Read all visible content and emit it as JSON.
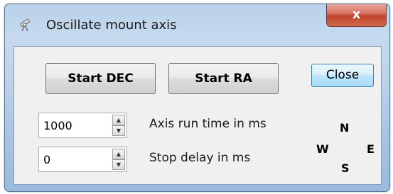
{
  "window": {
    "title": "Oscillate mount axis",
    "close_glyph": "x",
    "icon": "telescope-icon"
  },
  "buttons": {
    "start_dec": "Start DEC",
    "start_ra": "Start RA",
    "close": "Close"
  },
  "fields": {
    "runtime": {
      "value": "1000",
      "label": "Axis run time in ms"
    },
    "delay": {
      "value": "0",
      "label": "Stop delay in ms"
    }
  },
  "compass": {
    "north": "N",
    "west": "W",
    "east": "E",
    "south": "S"
  },
  "colors": {
    "title_gradient_top": "#b9d1ea",
    "client_bg": "#f0f0f0",
    "close_red": "#c2432b",
    "focus_blue": "#3c7fb1"
  }
}
